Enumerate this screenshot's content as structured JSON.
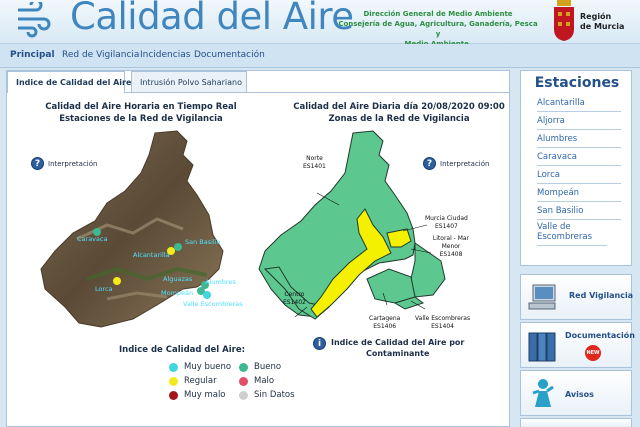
{
  "header": {
    "title": "Calidad del Aire",
    "dept_line1": "Dirección General de Medio Ambiente",
    "dept_line2": "Consejería de Agua, Agricultura, Ganadería, Pesca y",
    "dept_line3": "Medio Ambiente.",
    "region_line1": "Región",
    "region_line2": "de Murcia"
  },
  "nav": {
    "items": [
      "Principal",
      "Red de Vigilancia",
      "Incidencias",
      "Documentación"
    ]
  },
  "tabs": [
    {
      "label": "Indice de Calidad del Aire",
      "active": true
    },
    {
      "label": "Intrusión Polvo Sahariano",
      "active": false
    }
  ],
  "left_map": {
    "title_line1": "Calidad del Aire Horaria en Tiempo Real",
    "title_line2": "Estaciones de la Red de Vigilancia",
    "info_label": "Interpretación",
    "stations": [
      "Caravaca",
      "San Basilio",
      "Alcantarilla",
      "Alguazas",
      "Lorca",
      "Alumbres",
      "Mompeán",
      "Valle Escombreras"
    ]
  },
  "right_map": {
    "title_line1": "Calidad del Aire Diaria día 20/08/2020 09:00",
    "title_line2": "Zonas de la Red de Vigilancia",
    "info_label": "Interpretación",
    "zones": [
      {
        "name": "Norte",
        "code": "ES1401"
      },
      {
        "name": "Murcia Ciudad",
        "code": "ES1407"
      },
      {
        "name": "Litoral - Mar Menor",
        "code": "ES1408"
      },
      {
        "name": "Centro",
        "code": "ES1402"
      },
      {
        "name": "Cartagena",
        "code": "ES1406"
      },
      {
        "name": "Valle Escombreras",
        "code": "ES1404"
      }
    ],
    "contaminant_line1": "Indice de Calidad del Aire por",
    "contaminant_line2": "Contaminante"
  },
  "legend": {
    "title": "Indice de Calidad del Aire:",
    "items": [
      {
        "label": "Muy bueno",
        "color": "#3fd6e0"
      },
      {
        "label": "Bueno",
        "color": "#3db890"
      },
      {
        "label": "Regular",
        "color": "#f2ea1a"
      },
      {
        "label": "Malo",
        "color": "#e0506a"
      },
      {
        "label": "Muy malo",
        "color": "#a3161c"
      },
      {
        "label": "Sin Datos",
        "color": "#cfcfcf"
      }
    ]
  },
  "sidebar": {
    "title": "Estaciones",
    "items": [
      "Alcantarilla",
      "Aljorra",
      "Alumbres",
      "Caravaca",
      "Lorca",
      "Mompeán",
      "San Basilio",
      "Valle de Escombreras"
    ],
    "buttons": [
      "Red Vigilancia",
      "Documentación",
      "Avisos"
    ],
    "new_badge": "NEW"
  },
  "colors": {
    "accent": "#3f86bf",
    "zone_green": "#5cc890",
    "zone_yellow": "#f4f000"
  }
}
